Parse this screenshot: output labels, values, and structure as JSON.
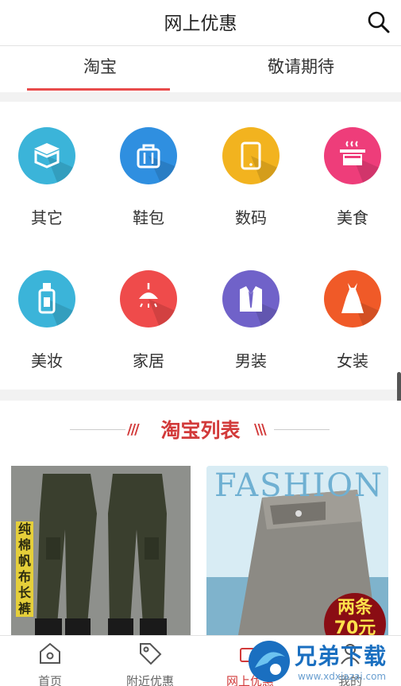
{
  "header": {
    "title": "网上优惠",
    "search_icon": "search-icon"
  },
  "tabs": [
    {
      "label": "淘宝",
      "active": true
    },
    {
      "label": "敬请期待",
      "active": false
    }
  ],
  "categories": [
    {
      "label": "其它",
      "icon": "box-icon",
      "color": "#3bb4d9"
    },
    {
      "label": "鞋包",
      "icon": "bag-icon",
      "color": "#2f8fe0"
    },
    {
      "label": "数码",
      "icon": "tablet-icon",
      "color": "#f2b31f"
    },
    {
      "label": "美食",
      "icon": "pot-icon",
      "color": "#ee3d7a"
    },
    {
      "label": "美妆",
      "icon": "cosmetic-bottle-icon",
      "color": "#3bb4d9"
    },
    {
      "label": "家居",
      "icon": "lamp-icon",
      "color": "#ef4b4b"
    },
    {
      "label": "男装",
      "icon": "suit-icon",
      "color": "#7062c9"
    },
    {
      "label": "女装",
      "icon": "dress-icon",
      "color": "#f05a28"
    }
  ],
  "list": {
    "title": "淘宝列表"
  },
  "products": [
    {
      "vertical_text": "纯棉帆布长裤"
    },
    {
      "banner_text": "FASHION",
      "badge_line1": "两条",
      "badge_line2": "70元"
    }
  ],
  "bottom_nav": [
    {
      "label": "首页",
      "icon": "home-icon"
    },
    {
      "label": "附近优惠",
      "icon": "tag-icon"
    },
    {
      "label": "网上优惠",
      "icon": "coupon-icon",
      "active": true
    },
    {
      "label": "我的",
      "icon": "user-icon"
    }
  ],
  "watermark": {
    "text": "兄弟下载",
    "url": "www.xdxiazai.com"
  }
}
